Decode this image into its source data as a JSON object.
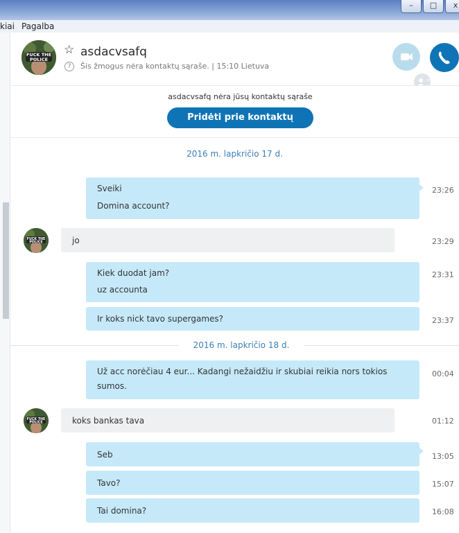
{
  "window": {
    "minimize": "–",
    "maximize": "□",
    "close": "x"
  },
  "menu": {
    "item1": "kiai",
    "item2": "Pagalba"
  },
  "contact": {
    "name": "asdacvsafq",
    "status": "Šis žmogus nėra kontaktų sąraše. | 15:10 Lietuva",
    "avatar_text": "FUCK THE POLICE"
  },
  "notice": {
    "text": "asdacvsafq nėra jūsų kontaktų sąraše",
    "button": "Pridėti prie kontaktų"
  },
  "dates": [
    "2016 m. lapkričio 17 d.",
    "2016 m. lapkričio 18 d."
  ],
  "messages": [
    {
      "dir": "out",
      "lines": [
        "Sveiki",
        "Domina account?"
      ],
      "time": "23:26"
    },
    {
      "dir": "in",
      "lines": [
        "jo"
      ],
      "time": "23:29"
    },
    {
      "dir": "out",
      "lines": [
        "Kiek duodat jam?",
        "uz accounta"
      ],
      "time": "23:31"
    },
    {
      "dir": "out",
      "lines": [
        "Ir koks nick tavo supergames?"
      ],
      "time": "23:37"
    },
    {
      "dir": "out",
      "lines": [
        "Už acc norėčiau 4 eur... Kadangi nežaidžiu ir skubiai reikia nors tokios",
        "sumos."
      ],
      "time": "00:04"
    },
    {
      "dir": "in",
      "lines": [
        "koks bankas tava"
      ],
      "time": "01:12"
    },
    {
      "dir": "out",
      "lines": [
        "Seb"
      ],
      "time": "13:05"
    },
    {
      "dir": "out",
      "lines": [
        "Tavo?"
      ],
      "time": "15:07"
    },
    {
      "dir": "out",
      "lines": [
        "Tai domina?"
      ],
      "time": "16:08"
    }
  ]
}
